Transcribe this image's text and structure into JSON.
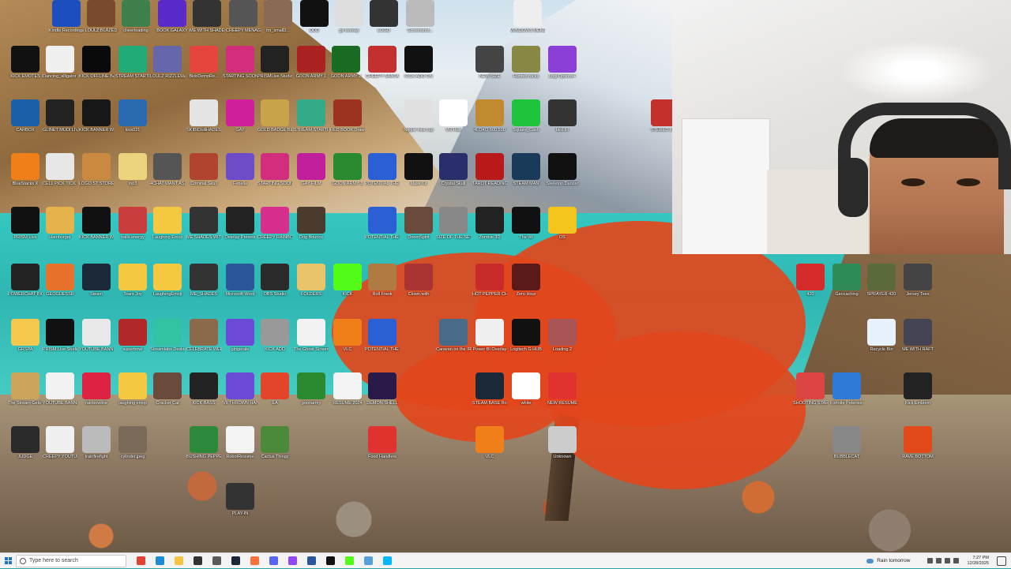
{
  "desktop_icons": [
    {
      "label": "Kindle Recordings",
      "color": "#1c4fbd"
    },
    {
      "label": "LOULZ BLAZED",
      "color": "#7a4b2a"
    },
    {
      "label": "cheerleading",
      "color": "#3f7f4b"
    },
    {
      "label": "BOOK GALAXY",
      "color": "#5b2bc9"
    },
    {
      "label": "ME WITH SHADES ON",
      "color": "#333"
    },
    {
      "label": "CREEPY MENAGERIE",
      "color": "#555"
    },
    {
      "label": "fm_small3...",
      "color": "#8b6a55"
    },
    {
      "label": "DDD",
      "color": "#111"
    },
    {
      "label": "gif overlay",
      "color": "#ddd"
    },
    {
      "label": "LOGO",
      "color": "#333"
    },
    {
      "label": "Screenshot...",
      "color": "#bbb"
    },
    {
      "label": "WINDOWS MENU",
      "color": "#eee"
    },
    {
      "label": "KICK EMOTES",
      "color": "#111"
    },
    {
      "label": "Dancing_alligator (1)",
      "color": "#f0f0f0"
    },
    {
      "label": "KICK OFFLINE BANNER",
      "color": "#0a0a0a"
    },
    {
      "label": "STREAM STARTING",
      "color": "#2a7"
    },
    {
      "label": "LOULZ RIZZLEMAN",
      "color": "#66a"
    },
    {
      "label": "BlobDemoRe...",
      "color": "#e6453e"
    },
    {
      "label": "STARTING SOON",
      "color": "#d12e7d"
    },
    {
      "label": "PRISMLive Studio",
      "color": "#222"
    },
    {
      "label": "GOON ARMY 1",
      "color": "#aa2222"
    },
    {
      "label": "GOON ARMY 2",
      "color": "#1a6b23"
    },
    {
      "label": "CREEPY SANTA",
      "color": "#c23030"
    },
    {
      "label": "KICK ADD ON",
      "color": "#111"
    },
    {
      "label": "NEW SIZE",
      "color": "#444"
    },
    {
      "label": "Hunted rocks",
      "color": "#884"
    },
    {
      "label": "Logi Options+",
      "color": "#8b3fd6"
    },
    {
      "label": "CARBOX",
      "color": "#1a5fa8"
    },
    {
      "label": "GLINET MUDI LIVE",
      "color": "#222"
    },
    {
      "label": "KICK BANNER WITH FLAMES",
      "color": "#171717"
    },
    {
      "label": "kick021",
      "color": "#2a6ab0"
    },
    {
      "label": "SKIBIDI SHADES",
      "color": "#444"
    },
    {
      "label": "lob",
      "color": "#e5e5e5"
    },
    {
      "label": "GAY",
      "color": "#d11f9c"
    },
    {
      "label": "GOLD BADGE BEAUTY",
      "color": "#c9a34a"
    },
    {
      "label": "STREAM STARTING",
      "color": "#3a8"
    },
    {
      "label": "RED BOOK Drawer",
      "color": "#9b3320"
    },
    {
      "label": "Nipple milk cup",
      "color": "#e0e0e0"
    },
    {
      "label": "VR Hub",
      "color": "#ffffff"
    },
    {
      "label": "4LOKO 500 500",
      "color": "#c28a2e"
    },
    {
      "label": "Square_Cash",
      "color": "#1ec53c"
    },
    {
      "label": "bird.IR",
      "color": "#333"
    },
    {
      "label": "STEREO LIVE",
      "color": "#c4302b"
    },
    {
      "label": "BlueStacks X",
      "color": "#f07f19"
    },
    {
      "label": "CELL PICK TICK TOCK",
      "color": "#e7e7e7"
    },
    {
      "label": "LOGO ST STORE",
      "color": "#c9893e"
    },
    {
      "label": "mp3",
      "color": "#ecd37e"
    },
    {
      "label": "4CHAT WANT ASSASSIN",
      "color": "#555"
    },
    {
      "label": "Criminal Skull",
      "color": "#b0442e"
    },
    {
      "label": "Fenella",
      "color": "#6e4bc9"
    },
    {
      "label": "STARTING SOON",
      "color": "#d12e7d"
    },
    {
      "label": "GAY FILM",
      "color": "#c1209d"
    },
    {
      "label": "GOON ARMY 3",
      "color": "#2a8a2f"
    },
    {
      "label": "POTENTIAL THE ONE",
      "color": "#2a5fd6"
    },
    {
      "label": "Mask Kit",
      "color": "#111"
    },
    {
      "label": "Crystal Skull",
      "color": "#2a2f6b"
    },
    {
      "label": "TAROT READING 1 SUB",
      "color": "#b81a1a"
    },
    {
      "label": "STEAM MAN",
      "color": "#1a3a5a"
    },
    {
      "label": "Skeleton Dancer",
      "color": "#111"
    },
    {
      "label": "PRISM Live",
      "color": "#111"
    },
    {
      "label": "Hamburger",
      "color": "#e6b24c"
    },
    {
      "label": "KICK BANNER WITH FLAMES",
      "color": "#111"
    },
    {
      "label": "balls.energy",
      "color": "#c93d3d"
    },
    {
      "label": "Laughing Emoji",
      "color": "#f5c842"
    },
    {
      "label": "ME SHADES WITH GLOW",
      "color": "#333"
    },
    {
      "label": "Overlay Presets",
      "color": "#222"
    },
    {
      "label": "CREEPY RAINBOW",
      "color": "#d72f8e"
    },
    {
      "label": "Dog Bounce",
      "color": "#4a3b2e"
    },
    {
      "label": "POTENTIAL THE ONE",
      "color": "#2a5fd6"
    },
    {
      "label": "DoomSpirit",
      "color": "#6a4a3a"
    },
    {
      "label": "SIZE OF THE SET",
      "color": "#888"
    },
    {
      "label": "Zombie 3D",
      "color": "#222"
    },
    {
      "label": "The Wi",
      "color": "#111"
    },
    {
      "label": "DS",
      "color": "#f4c51c"
    },
    {
      "label": "POWERCHAT BIG TALK",
      "color": "#222"
    },
    {
      "label": "GEOGUESSR",
      "color": "#e8722b"
    },
    {
      "label": "Steam",
      "color": "#1b2838"
    },
    {
      "label": "Tears Joy",
      "color": "#f5c842"
    },
    {
      "label": "LaughingEmoji",
      "color": "#f5c842"
    },
    {
      "label": "ME_SHADES",
      "color": "#333"
    },
    {
      "label": "Microsoft Word",
      "color": "#2b579a"
    },
    {
      "label": "OBS Studio",
      "color": "#2a2a2a"
    },
    {
      "label": "FOLDERS",
      "color": "#e9c46a"
    },
    {
      "label": "KICK",
      "color": "#53fc18"
    },
    {
      "label": "Roll Frank",
      "color": "#b07a43"
    },
    {
      "label": "Clown with",
      "color": "#a33"
    },
    {
      "label": "HOT PEPPER CHALLENGE",
      "color": "#c92a2a"
    },
    {
      "label": "Zero Hour",
      "color": "#5a1a1a"
    },
    {
      "label": "420",
      "color": "#d62b2b"
    },
    {
      "label": "Geocaching",
      "color": "#2e8b57"
    },
    {
      "label": "SPRAYER 420",
      "color": "#5a6a3a"
    },
    {
      "label": "Jersey Tees",
      "color": "#444"
    },
    {
      "label": "GRSPA",
      "color": "#f2c94c"
    },
    {
      "label": "PRISM Live Studio",
      "color": "#111"
    },
    {
      "label": "YOUTUBE BANNER",
      "color": "#e8e8e8"
    },
    {
      "label": "superbowl",
      "color": "#b12828"
    },
    {
      "label": "Streamlabs Desktop",
      "color": "#31c3a2"
    },
    {
      "label": "CELEBRATE WEEKEND",
      "color": "#8a6a4a"
    },
    {
      "label": "gingerale",
      "color": "#6b4bd6"
    },
    {
      "label": "KICK ADD",
      "color": "#999"
    },
    {
      "label": "The Ghost Screen",
      "color": "#f2f2f2"
    },
    {
      "label": "VLC",
      "color": "#f07f19"
    },
    {
      "label": "POTENTIAL THE ONE",
      "color": "#2a5fd6"
    },
    {
      "label": "Caravan on the IR",
      "color": "#4a6a8a"
    },
    {
      "label": "Power BI Overlay",
      "color": "#f0f0f0"
    },
    {
      "label": "Logitech G HUB",
      "color": "#111"
    },
    {
      "label": "Loading 2",
      "color": "#a55"
    },
    {
      "label": "Recycle Bin",
      "color": "#e8f2ff"
    },
    {
      "label": "ME WITH RAFT",
      "color": "#445"
    },
    {
      "label": "The Stream Gets Cooler",
      "color": "#cda45c"
    },
    {
      "label": "YOUTUBE BANNER NEW",
      "color": "#f2f2f2"
    },
    {
      "label": "rainbowline",
      "color": "#d24"
    },
    {
      "label": "laughing emoji",
      "color": "#f5c842"
    },
    {
      "label": "Cracker Cat",
      "color": "#6a4a3a"
    },
    {
      "label": "KICK BASS",
      "color": "#222"
    },
    {
      "label": "VII THROWN HAND IMAGE",
      "color": "#6b4bd6"
    },
    {
      "label": "EA",
      "color": "#e2452a"
    },
    {
      "label": "goonarmy",
      "color": "#2a8a2f"
    },
    {
      "label": "RESUME 2024",
      "color": "#f3f3f3"
    },
    {
      "label": "DEMON SHELL",
      "color": "#2a1a4a"
    },
    {
      "label": "STEAM BASE Rogue",
      "color": "#1b2838"
    },
    {
      "label": "white",
      "color": "#ffffff"
    },
    {
      "label": "NEW RESUME",
      "color": "#e0322f"
    },
    {
      "label": "SHOOTING STAR",
      "color": "#d44"
    },
    {
      "label": "Fortnite Peterson",
      "color": "#2f7ad6"
    },
    {
      "label": "Kick Emblem",
      "color": "#222"
    },
    {
      "label": "JUDGE",
      "color": "#2a2a2a"
    },
    {
      "label": "CREEPY YOUTUBE BANNER",
      "color": "#f0f0f0"
    },
    {
      "label": "trainfirefight",
      "color": "#bbb"
    },
    {
      "label": "cylinder.jpeg",
      "color": "#7a6a5a"
    },
    {
      "label": "BUSHING PEPPER",
      "color": "#2d8a3a"
    },
    {
      "label": "RobotResume",
      "color": "#f3f3f3"
    },
    {
      "label": "Cactus Thingy",
      "color": "#4a8a3a"
    },
    {
      "label": "Food Handlers",
      "color": "#e0322f"
    },
    {
      "label": "VLC",
      "color": "#f07f19"
    },
    {
      "label": "Unknown",
      "color": "#ccc"
    },
    {
      "label": "BUBBLECAT",
      "color": "#888"
    },
    {
      "label": "RAVE BOTTOM",
      "color": "#e24a1a"
    },
    {
      "label": "PLAY-IN",
      "color": "#333"
    }
  ],
  "taskbar": {
    "search_placeholder": "Type here to search",
    "apps": [
      {
        "name": "chrome",
        "color": "#e34133"
      },
      {
        "name": "edge",
        "color": "#1b8bd3"
      },
      {
        "name": "file-explorer",
        "color": "#f5c542"
      },
      {
        "name": "obs",
        "color": "#333333"
      },
      {
        "name": "task-view",
        "color": "#5a5a5a"
      },
      {
        "name": "steam",
        "color": "#1b2838"
      },
      {
        "name": "firefox",
        "color": "#ff7139"
      },
      {
        "name": "discord",
        "color": "#5865f2"
      },
      {
        "name": "twitch",
        "color": "#9146ff"
      },
      {
        "name": "word",
        "color": "#2b579a"
      },
      {
        "name": "prism",
        "color": "#111111"
      },
      {
        "name": "kick",
        "color": "#53fc18"
      },
      {
        "name": "notepad",
        "color": "#5aa0d8"
      },
      {
        "name": "logitech",
        "color": "#00b8fc"
      }
    ],
    "weather": "Rain tomorrow",
    "time": "7:27 PM",
    "date": "12/28/2025"
  }
}
